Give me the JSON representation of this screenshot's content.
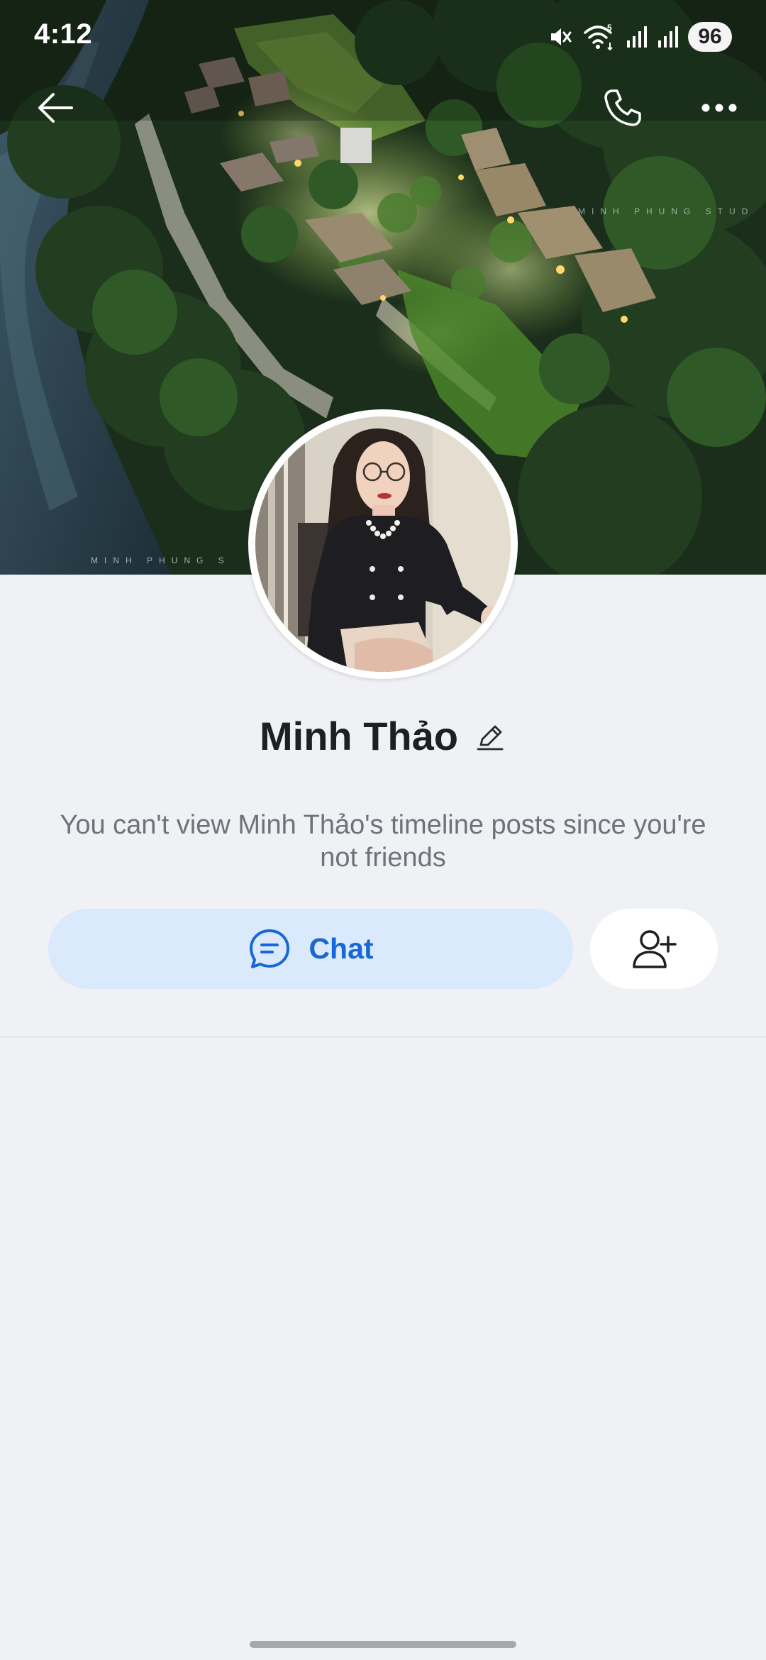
{
  "status_bar": {
    "time": "4:12",
    "battery": "96",
    "wifi_badge": "5",
    "icons": [
      "mute-icon",
      "wifi-icon",
      "signal-icon",
      "signal-icon",
      "battery-icon"
    ]
  },
  "cover": {
    "watermark_top": "MINH PHUNG STUD",
    "watermark_bottom": "MINH PHUNG S"
  },
  "nav": {
    "back_icon": "arrow-left-icon",
    "call_icon": "phone-icon",
    "more_icon": "more-horizontal-icon"
  },
  "profile": {
    "name": "Minh Thảo",
    "edit_icon": "pencil-icon",
    "notice": "You can't view Minh Thảo's timeline posts since you're not friends"
  },
  "actions": {
    "chat_label": "Chat",
    "chat_icon": "chat-bubble-icon",
    "add_friend_icon": "add-friend-icon"
  },
  "colors": {
    "accent": "#1668d8",
    "chat_button_bg": "#dbe9fd",
    "page_bg": "#f0f1f5"
  }
}
